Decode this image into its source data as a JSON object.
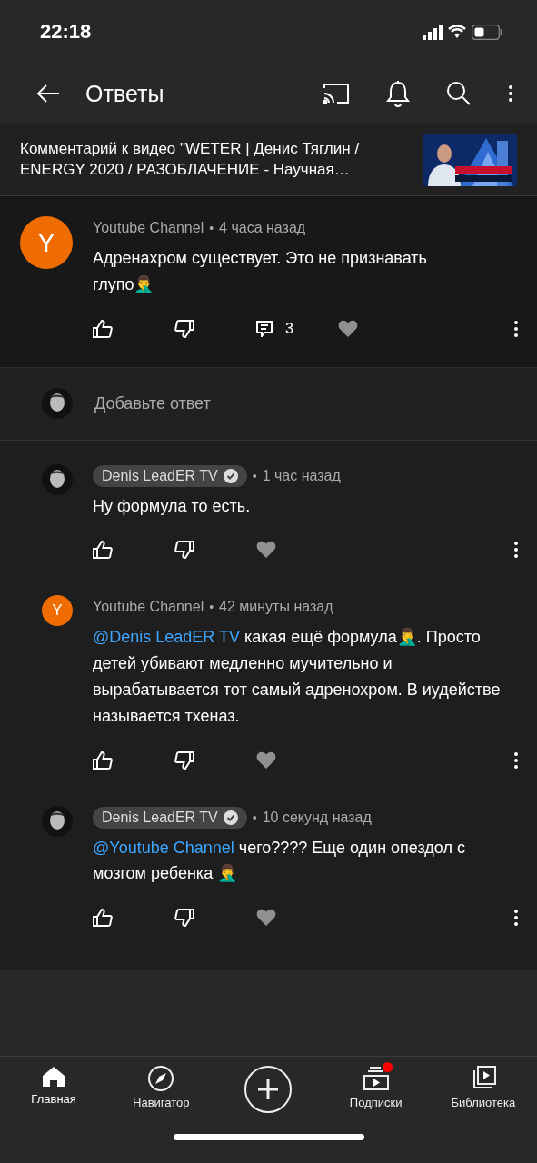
{
  "status_bar": {
    "time": "22:18"
  },
  "header": {
    "title": "Ответы"
  },
  "video_ref": {
    "text": "Комментарий к видео \"WETER | Денис Тяглин / ENERGY 2020 / РАЗОБЛАЧЕНИЕ - Научная…"
  },
  "main_comment": {
    "avatar": {
      "kind": "letter",
      "letter": "Y",
      "color": "#ef6c00"
    },
    "author": "Youtube Channel",
    "verified": false,
    "separator": "•",
    "time": "4 часа назад",
    "text": "Адренахром существует. Это не признавать глупо🤦‍♂️",
    "reply_count": "3"
  },
  "reply_input": {
    "placeholder": "Добавьте ответ"
  },
  "replies": [
    {
      "author": "Denis LeadER TV",
      "verified": true,
      "separator": "•",
      "time": "1 час назад",
      "text": "Ну формула то есть."
    },
    {
      "avatar": {
        "kind": "letter",
        "letter": "Y",
        "color": "#ef6c00"
      },
      "author": "Youtube Channel",
      "verified": false,
      "separator": "•",
      "time": "42 минуты назад",
      "mention": "@Denis LeadER TV",
      "text": "какая ещё формула🤦‍♂️. Просто детей убивают медленно мучительно и вырабатывается тот самый адренохром. В иудействе называется тхеназ."
    },
    {
      "author": "Denis LeadER TV",
      "verified": true,
      "separator": "•",
      "time": "10 секунд назад",
      "mention": "@Youtube Channel",
      "text": "чего???? Еще один опездол с мозгом ребенка 🤦‍♂️"
    }
  ],
  "bottom_nav": [
    {
      "label": "Главная",
      "kind": "home",
      "selected": true,
      "badge": false
    },
    {
      "label": "Навигатор",
      "kind": "compass",
      "selected": false,
      "badge": false
    },
    {
      "kind": "create",
      "selected": false,
      "badge": false
    },
    {
      "label": "Подписки",
      "kind": "subs",
      "selected": false,
      "badge": true
    },
    {
      "label": "Библиотека",
      "kind": "library",
      "selected": false,
      "badge": false
    }
  ]
}
